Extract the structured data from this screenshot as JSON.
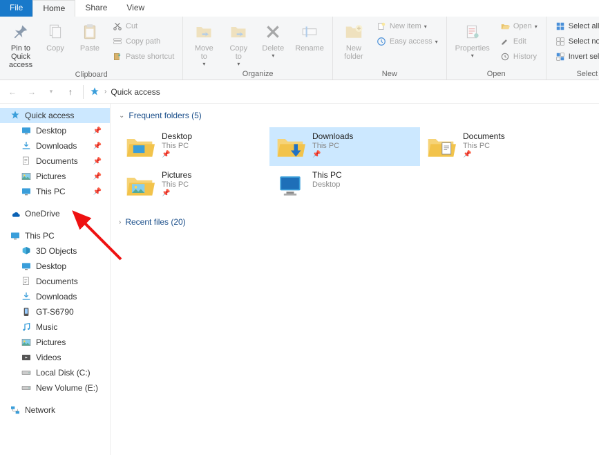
{
  "tabs": {
    "file": "File",
    "home": "Home",
    "share": "Share",
    "view": "View"
  },
  "ribbon": {
    "clipboard": {
      "label": "Clipboard",
      "pin": "Pin to Quick\naccess",
      "copy": "Copy",
      "paste": "Paste",
      "cut": "Cut",
      "copypath": "Copy path",
      "pasteshortcut": "Paste shortcut"
    },
    "organize": {
      "label": "Organize",
      "moveto": "Move\nto",
      "copyto": "Copy\nto",
      "delete": "Delete",
      "rename": "Rename"
    },
    "new": {
      "label": "New",
      "newfolder": "New\nfolder",
      "newitem": "New item",
      "easyaccess": "Easy access"
    },
    "open": {
      "label": "Open",
      "properties": "Properties",
      "open": "Open",
      "edit": "Edit",
      "history": "History"
    },
    "select": {
      "label": "Select",
      "selectall": "Select all",
      "selectnone": "Select none",
      "invert": "Invert selection"
    }
  },
  "breadcrumb": {
    "current": "Quick access"
  },
  "sidebar": {
    "quickaccess": "Quick access",
    "qa_items": [
      {
        "label": "Desktop"
      },
      {
        "label": "Downloads"
      },
      {
        "label": "Documents"
      },
      {
        "label": "Pictures"
      },
      {
        "label": "This PC"
      }
    ],
    "onedrive": "OneDrive",
    "thispc": "This PC",
    "pc_items": [
      {
        "label": "3D Objects"
      },
      {
        "label": "Desktop"
      },
      {
        "label": "Documents"
      },
      {
        "label": "Downloads"
      },
      {
        "label": "GT-S6790"
      },
      {
        "label": "Music"
      },
      {
        "label": "Pictures"
      },
      {
        "label": "Videos"
      },
      {
        "label": "Local Disk (C:)"
      },
      {
        "label": "New Volume (E:)"
      }
    ],
    "network": "Network"
  },
  "content": {
    "frequent_header": "Frequent folders (5)",
    "recent_header": "Recent files (20)",
    "frequent": [
      {
        "name": "Desktop",
        "loc": "This PC"
      },
      {
        "name": "Downloads",
        "loc": "This PC"
      },
      {
        "name": "Documents",
        "loc": "This PC"
      },
      {
        "name": "Pictures",
        "loc": "This PC"
      },
      {
        "name": "This PC",
        "loc": "Desktop"
      }
    ]
  }
}
